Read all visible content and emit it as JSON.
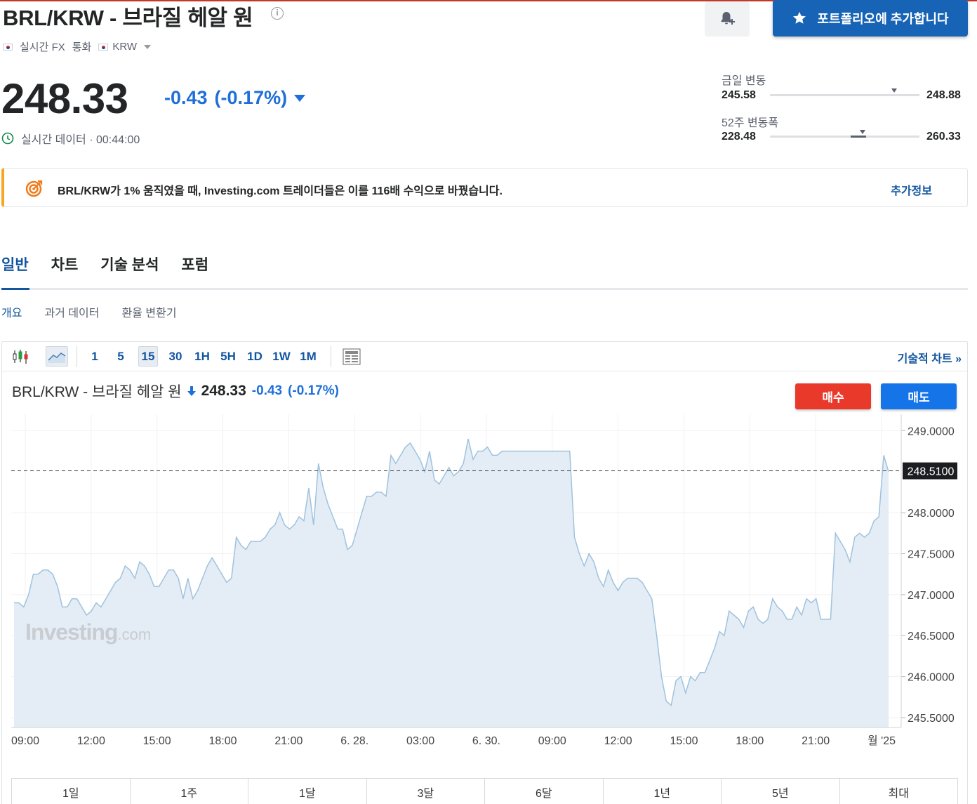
{
  "header": {
    "title": "BRL/KRW - 브라질 헤알 원",
    "meta": [
      "실시간 FX",
      "통화",
      "KRW"
    ],
    "portfolio_button": "포트폴리오에 추가합니다"
  },
  "quote": {
    "price": "248.33",
    "change": "-0.43",
    "change_pct": "(-0.17%)",
    "realtime_label": "실시간 데이터 · 00:44:00",
    "day_range": {
      "label": "금일 변동",
      "low": "245.58",
      "high": "248.88",
      "position": 0.83
    },
    "week52_range": {
      "label": "52주 변동폭",
      "low": "228.48",
      "high": "260.33",
      "position": 0.62
    }
  },
  "promo": {
    "text": "BRL/KRW가 1% 움직였을 때, Investing.com 트레이더들은 이를 116배 수익으로 바꿨습니다.",
    "link": "추가정보"
  },
  "tabs": [
    "일반",
    "차트",
    "기술 분석",
    "포럼"
  ],
  "subtabs": [
    "개요",
    "과거 데이터",
    "환율 변환기"
  ],
  "toolbar": {
    "intervals": [
      "1",
      "5",
      "15",
      "30",
      "1H",
      "5H",
      "1D",
      "1W",
      "1M"
    ],
    "active_interval": "15",
    "tech_chart_link": "기술적 차트 »"
  },
  "chart_header": {
    "name": "BRL/KRW - 브라질 헤알 원",
    "price": "248.33",
    "change": "-0.43",
    "change_pct": "(-0.17%)",
    "buy": "매수",
    "sell": "매도"
  },
  "watermark": {
    "main": "Investing",
    "suffix": ".com"
  },
  "periods": [
    "1일",
    "1주",
    "1달",
    "3달",
    "6달",
    "1년",
    "5년",
    "최대"
  ],
  "colors": {
    "accent": "#1256a0",
    "down": "#1e6fd9",
    "buy": "#e8392b",
    "sell": "#1574e8",
    "line": "#9fc2de",
    "fill": "#e4edf5"
  },
  "chart_data": {
    "type": "area",
    "title": "BRL/KRW - 브라질 헤알 원",
    "xlabel": "",
    "ylabel": "",
    "x_ticks": [
      "09:00",
      "12:00",
      "15:00",
      "18:00",
      "21:00",
      "6. 28.",
      "03:00",
      "6. 30.",
      "09:00",
      "12:00",
      "15:00",
      "18:00",
      "21:00",
      "월 '25"
    ],
    "y_ticks": [
      "249.0000",
      "248.0000",
      "247.5000",
      "247.0000",
      "246.5000",
      "246.0000",
      "245.5000"
    ],
    "ylim": [
      245.38,
      249.2
    ],
    "last_price_label": "248.5100",
    "last_price": 248.51,
    "values": [
      246.9,
      246.9,
      246.85,
      247.0,
      247.25,
      247.25,
      247.3,
      247.3,
      247.25,
      247.1,
      246.85,
      246.85,
      246.95,
      246.95,
      246.85,
      246.75,
      246.8,
      246.9,
      246.85,
      246.95,
      247.05,
      247.15,
      247.2,
      247.35,
      247.3,
      247.2,
      247.4,
      247.35,
      247.25,
      247.1,
      247.1,
      247.2,
      247.3,
      247.3,
      247.2,
      246.95,
      247.2,
      246.95,
      247.05,
      247.2,
      247.35,
      247.45,
      247.35,
      247.25,
      247.15,
      247.2,
      247.7,
      247.6,
      247.55,
      247.65,
      247.65,
      247.65,
      247.7,
      247.8,
      247.85,
      248.0,
      247.85,
      247.8,
      247.85,
      247.95,
      247.9,
      248.3,
      247.85,
      248.6,
      248.3,
      248.1,
      247.95,
      247.8,
      247.8,
      247.55,
      247.6,
      247.8,
      248.0,
      248.2,
      248.2,
      248.25,
      248.25,
      248.2,
      248.7,
      248.6,
      248.7,
      248.8,
      248.85,
      248.75,
      248.65,
      248.5,
      248.75,
      248.4,
      248.35,
      248.45,
      248.55,
      248.45,
      248.5,
      248.6,
      248.9,
      248.65,
      248.75,
      248.75,
      248.8,
      248.7,
      248.7,
      248.75,
      248.75,
      248.75,
      248.75,
      248.75,
      248.75,
      248.75,
      248.75,
      248.75,
      248.75,
      248.75,
      248.75,
      248.75,
      248.75,
      248.75,
      247.7,
      247.5,
      247.35,
      247.5,
      247.4,
      247.2,
      247.1,
      247.3,
      247.15,
      247.05,
      247.15,
      247.2,
      247.2,
      247.2,
      247.15,
      247.05,
      246.95,
      246.5,
      246.0,
      245.7,
      245.65,
      245.95,
      246.0,
      245.8,
      246.0,
      245.95,
      246.05,
      246.05,
      246.2,
      246.35,
      246.55,
      246.5,
      246.8,
      246.75,
      246.7,
      246.6,
      246.8,
      246.85,
      246.7,
      246.65,
      246.7,
      246.95,
      246.85,
      246.8,
      246.7,
      246.7,
      246.85,
      246.75,
      246.95,
      246.9,
      246.95,
      246.7,
      246.7,
      246.7,
      247.75,
      247.65,
      247.55,
      247.4,
      247.7,
      247.75,
      247.7,
      247.75,
      247.9,
      247.95,
      248.7,
      248.5
    ]
  }
}
